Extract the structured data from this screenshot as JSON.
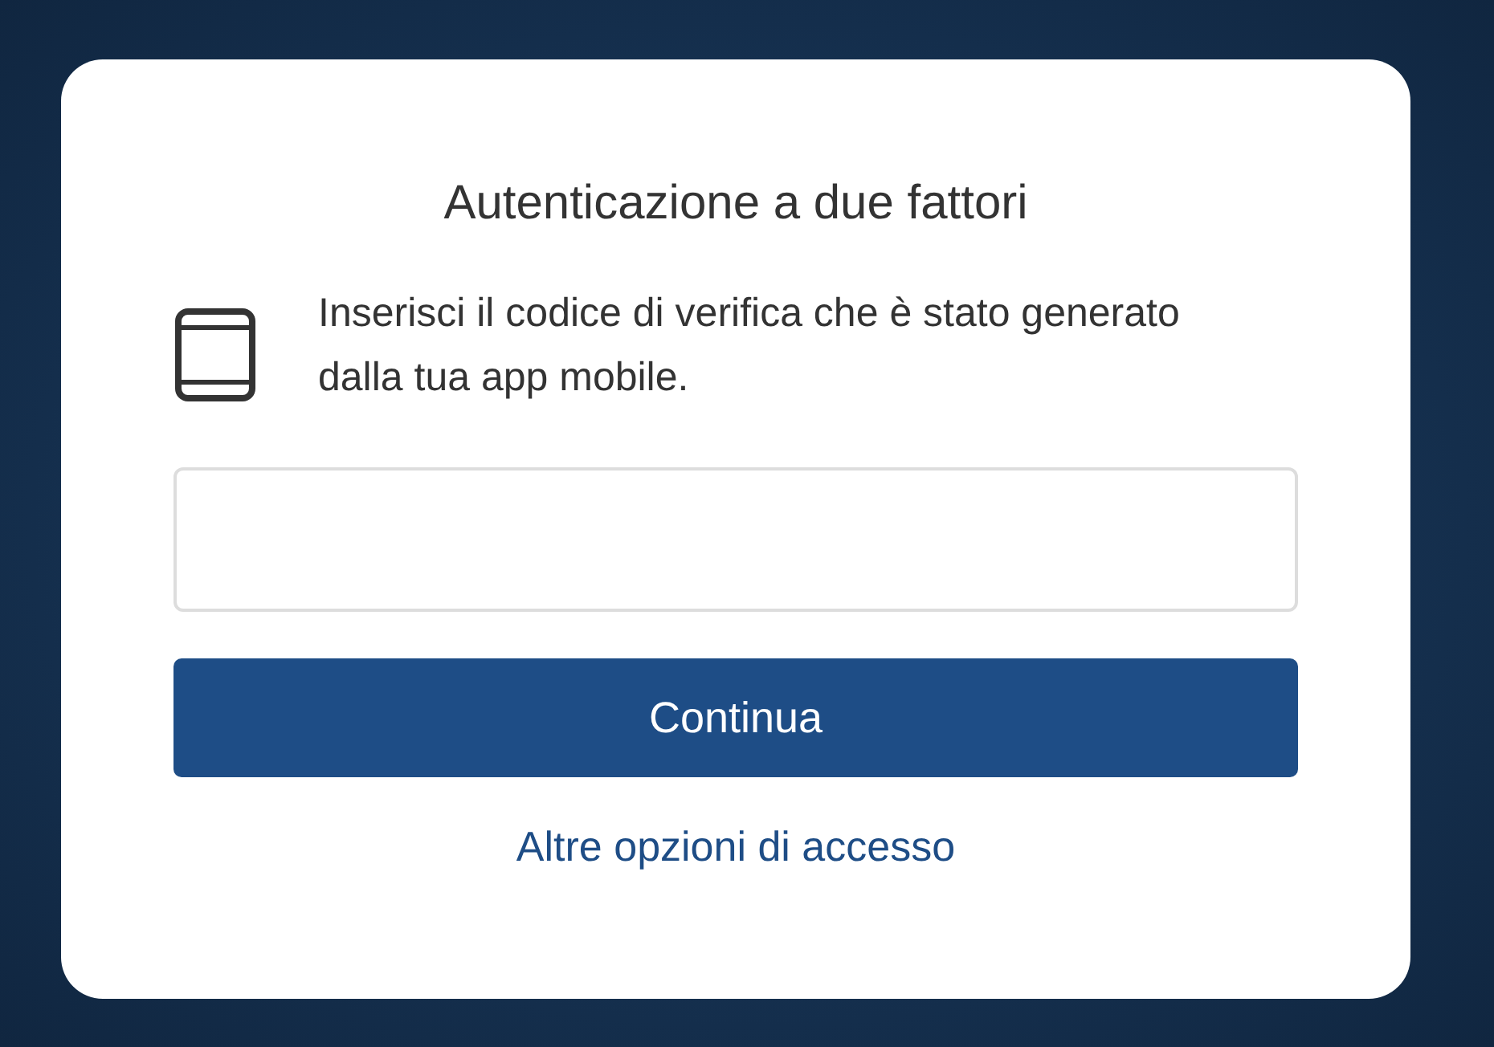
{
  "dialog": {
    "title": "Autenticazione a due fattori",
    "message": "Inserisci il codice di verifica che è stato generato dalla tua app mobile.",
    "primary_button": "Continua",
    "link": "Altre opzioni di accesso"
  }
}
